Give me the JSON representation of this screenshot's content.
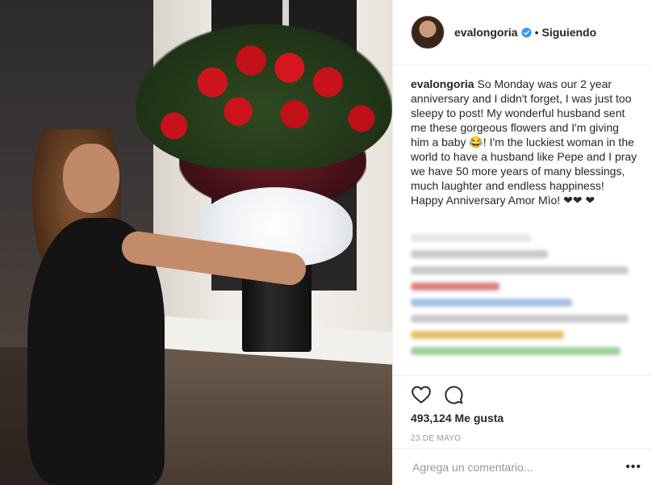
{
  "header": {
    "username": "evalongoria",
    "separator": "•",
    "follow_status": "Siguiendo"
  },
  "caption": {
    "username": "evalongoria",
    "text": "So Monday was our 2 year anniversary and I didn't forget, I was just too sleepy to post! My wonderful husband sent me these gorgeous flowers and I'm giving him a baby 😂! I'm the luckiest woman in the world to have a husband like Pepe and I pray we have 50 more years of many blessings, much laughter and endless happiness! Happy Anniversary Amor Mìo! ❤❤ ❤"
  },
  "stats": {
    "likes": "493,124 Me gusta",
    "date": "23 DE MAYO"
  },
  "comment": {
    "placeholder": "Agrega un comentario...",
    "more": "•••"
  },
  "icons": {
    "like": "heart-icon",
    "comment": "comment-bubble-icon",
    "verified": "verified-badge-icon",
    "more": "more-options-icon"
  },
  "colors": {
    "text": "#262626",
    "muted": "#999999",
    "verified": "#3897f0"
  }
}
